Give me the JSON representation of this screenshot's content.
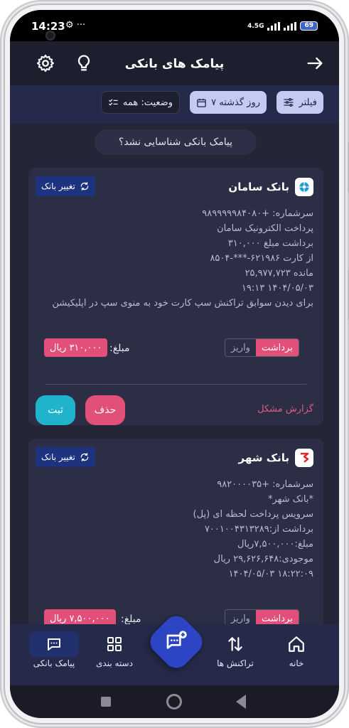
{
  "status": {
    "time": "14:23",
    "extra": "⚙ ···",
    "network": "4.5G",
    "battery": "69"
  },
  "header": {
    "title": "پیامک های بانکی"
  },
  "filters": {
    "filter_label": "فیلتر",
    "range_label": "۷ روز گذشته",
    "status_label": "وضعیت: همه"
  },
  "unrecognized": "پیامک بانکی شناسایی نشد؟",
  "cards": [
    {
      "bank": "بانک سامان",
      "change_bank": "تغییر بانک",
      "sms": [
        "سرشماره: +۹۸۹۹۹۹۹۸۴۰۸۰",
        "پرداخت الکترونیک سامان",
        "برداشت مبلغ ۳۱۰,۰۰۰",
        "از کارت ۶۲۱۹۸۶-***-۸۵۰۴",
        "مانده ۲۵,۹۷۷,۷۲۳",
        "۱۴۰۴/۰۵/۰۳ ۱۹:۱۳",
        "برای دیدن سوابق تراکنش سپ کارت خود به منوی سپ در اپلیکیشن"
      ],
      "deposit": "واریز",
      "withdraw": "برداشت",
      "amount_label": "مبلغ:",
      "amount": "۳۱۰,۰۰۰ ریال",
      "report": "گزارش مشکل",
      "delete": "حذف",
      "save": "ثبت"
    },
    {
      "bank": "بانک شهر",
      "change_bank": "تغییر بانک",
      "sms": [
        "سرشماره: +۹۸۲۰۰۰۰۳۵",
        "*بانک شهر*",
        "سرویس پرداخت لحظه ای (پل)",
        "برداشت از:۷۰۰۱۰۰۴۳۱۳۲۸۹",
        "مبلغ:۷,۵۰۰,۰۰۰ریال",
        "موجودی:۲۹,۶۲۶,۶۴۸ ریال",
        "۱۸:۲۲:۰۹ ۱۴۰۴/۰۵/۰۳"
      ],
      "deposit": "واریز",
      "withdraw": "برداشت",
      "amount_label": "مبلغ:",
      "amount": "۷,۵۰۰,۰۰۰ ریال"
    }
  ],
  "nav": {
    "home": "خانه",
    "transactions": "تراکنش ها",
    "categories": "دسته بندی",
    "sms": "پیامک بانکی"
  },
  "colors": {
    "accent": "#2b45c4",
    "danger": "#e24f78",
    "confirm": "#1fb4cc",
    "background": "#242638"
  }
}
